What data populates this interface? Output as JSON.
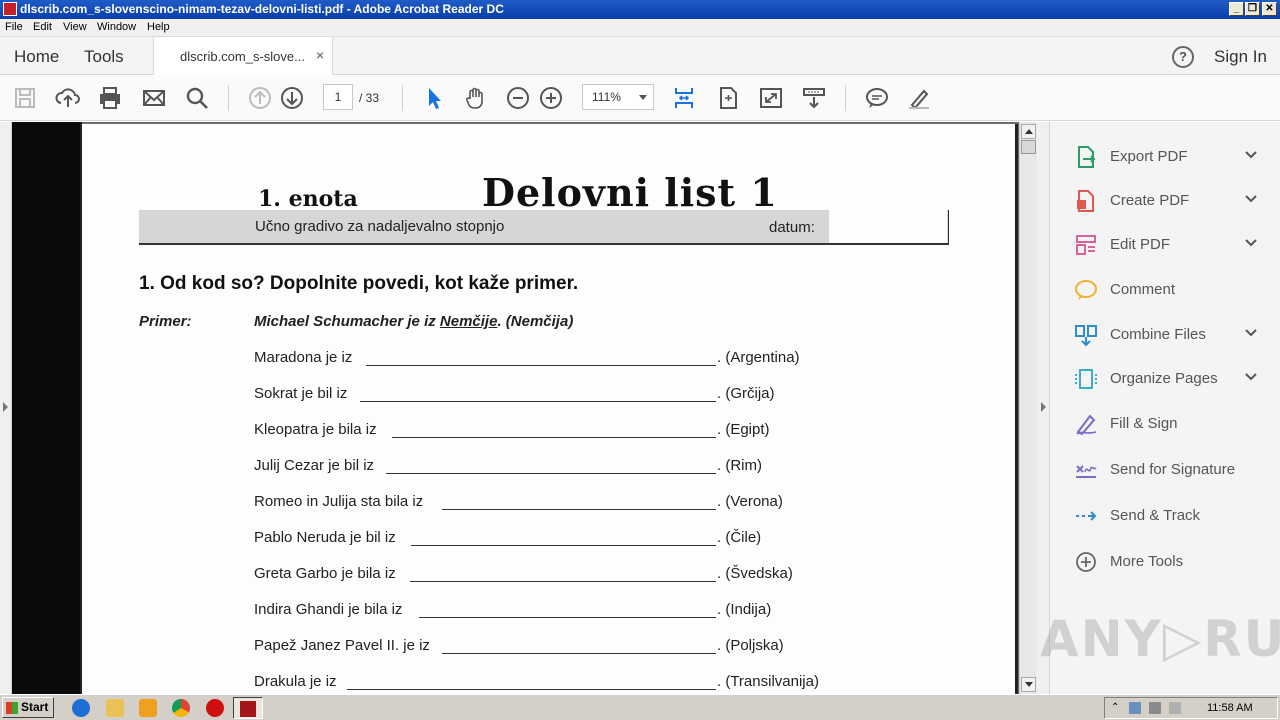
{
  "window": {
    "title": "dlscrib.com_s-slovenscino-nimam-tezav-delovni-listi.pdf - Adobe Acrobat Reader DC",
    "controls": {
      "minimize": "_",
      "restore": "❐",
      "close": "✕"
    }
  },
  "menu": [
    "File",
    "Edit",
    "View",
    "Window",
    "Help"
  ],
  "tabs": {
    "home": "Home",
    "tools": "Tools",
    "document": "dlscrib.com_s-slove...",
    "close": "×",
    "help": "?",
    "sign_in": "Sign In"
  },
  "toolbar": {
    "page_current": "1",
    "page_total": "/ 33",
    "zoom": "111%"
  },
  "document": {
    "unit_label": "1. enota",
    "worksheet_title": "Delovni list 1",
    "subtitle": "Učno gradivo za nadaljevalno stopnjo",
    "date_label": "datum:",
    "exercise": "1. Od kod so? Dopolnite povedi, kot kaže primer.",
    "example_label": "Primer:",
    "example_before": "Michael Schumacher je iz ",
    "example_underlined": "Nemčije",
    "example_after": ". (Nemčija)",
    "rows": [
      {
        "text": "Maradona je iz",
        "answer": ". (Argentina)"
      },
      {
        "text": "Sokrat je bil iz",
        "answer": ". (Grčija)"
      },
      {
        "text": "Kleopatra je bila iz",
        "answer": ". (Egipt)"
      },
      {
        "text": "Julij Cezar je bil iz",
        "answer": ". (Rim)"
      },
      {
        "text": "Romeo in Julija sta bila iz",
        "answer": ". (Verona)"
      },
      {
        "text": "Pablo Neruda je bil iz",
        "answer": ". (Čile)"
      },
      {
        "text": "Greta Garbo je bila iz",
        "answer": ". (Švedska)"
      },
      {
        "text": "Indira Ghandi je bila iz",
        "answer": ". (Indija)"
      },
      {
        "text": "Papež Janez Pavel II. je iz",
        "answer": ". (Poljska)"
      },
      {
        "text": "Drakula je iz",
        "answer": ". (Transilvanija)"
      }
    ]
  },
  "right_panel": {
    "items": [
      {
        "label": "Export PDF",
        "icon": "export-pdf-icon",
        "color": "#2a9d6b",
        "expandable": true
      },
      {
        "label": "Create PDF",
        "icon": "create-pdf-icon",
        "color": "#e0584f",
        "expandable": true
      },
      {
        "label": "Edit PDF",
        "icon": "edit-pdf-icon",
        "color": "#d9629b",
        "expandable": true
      },
      {
        "label": "Comment",
        "icon": "comment-icon",
        "color": "#f2b132",
        "expandable": false
      },
      {
        "label": "Combine Files",
        "icon": "combine-files-icon",
        "color": "#2a8ed0",
        "expandable": true
      },
      {
        "label": "Organize Pages",
        "icon": "organize-pages-icon",
        "color": "#3ab0c6",
        "expandable": true
      },
      {
        "label": "Fill & Sign",
        "icon": "fill-sign-icon",
        "color": "#7b6cc8",
        "expandable": false
      },
      {
        "label": "Send for Signature",
        "icon": "send-signature-icon",
        "color": "#7b6cc8",
        "expandable": false
      },
      {
        "label": "Send & Track",
        "icon": "send-track-icon",
        "color": "#2a8ed0",
        "expandable": false
      },
      {
        "label": "More Tools",
        "icon": "more-tools-icon",
        "color": "#666666",
        "expandable": false
      }
    ]
  },
  "watermark": "ANY▷RUN",
  "taskbar": {
    "start": "Start",
    "clock": "11:58 AM"
  }
}
